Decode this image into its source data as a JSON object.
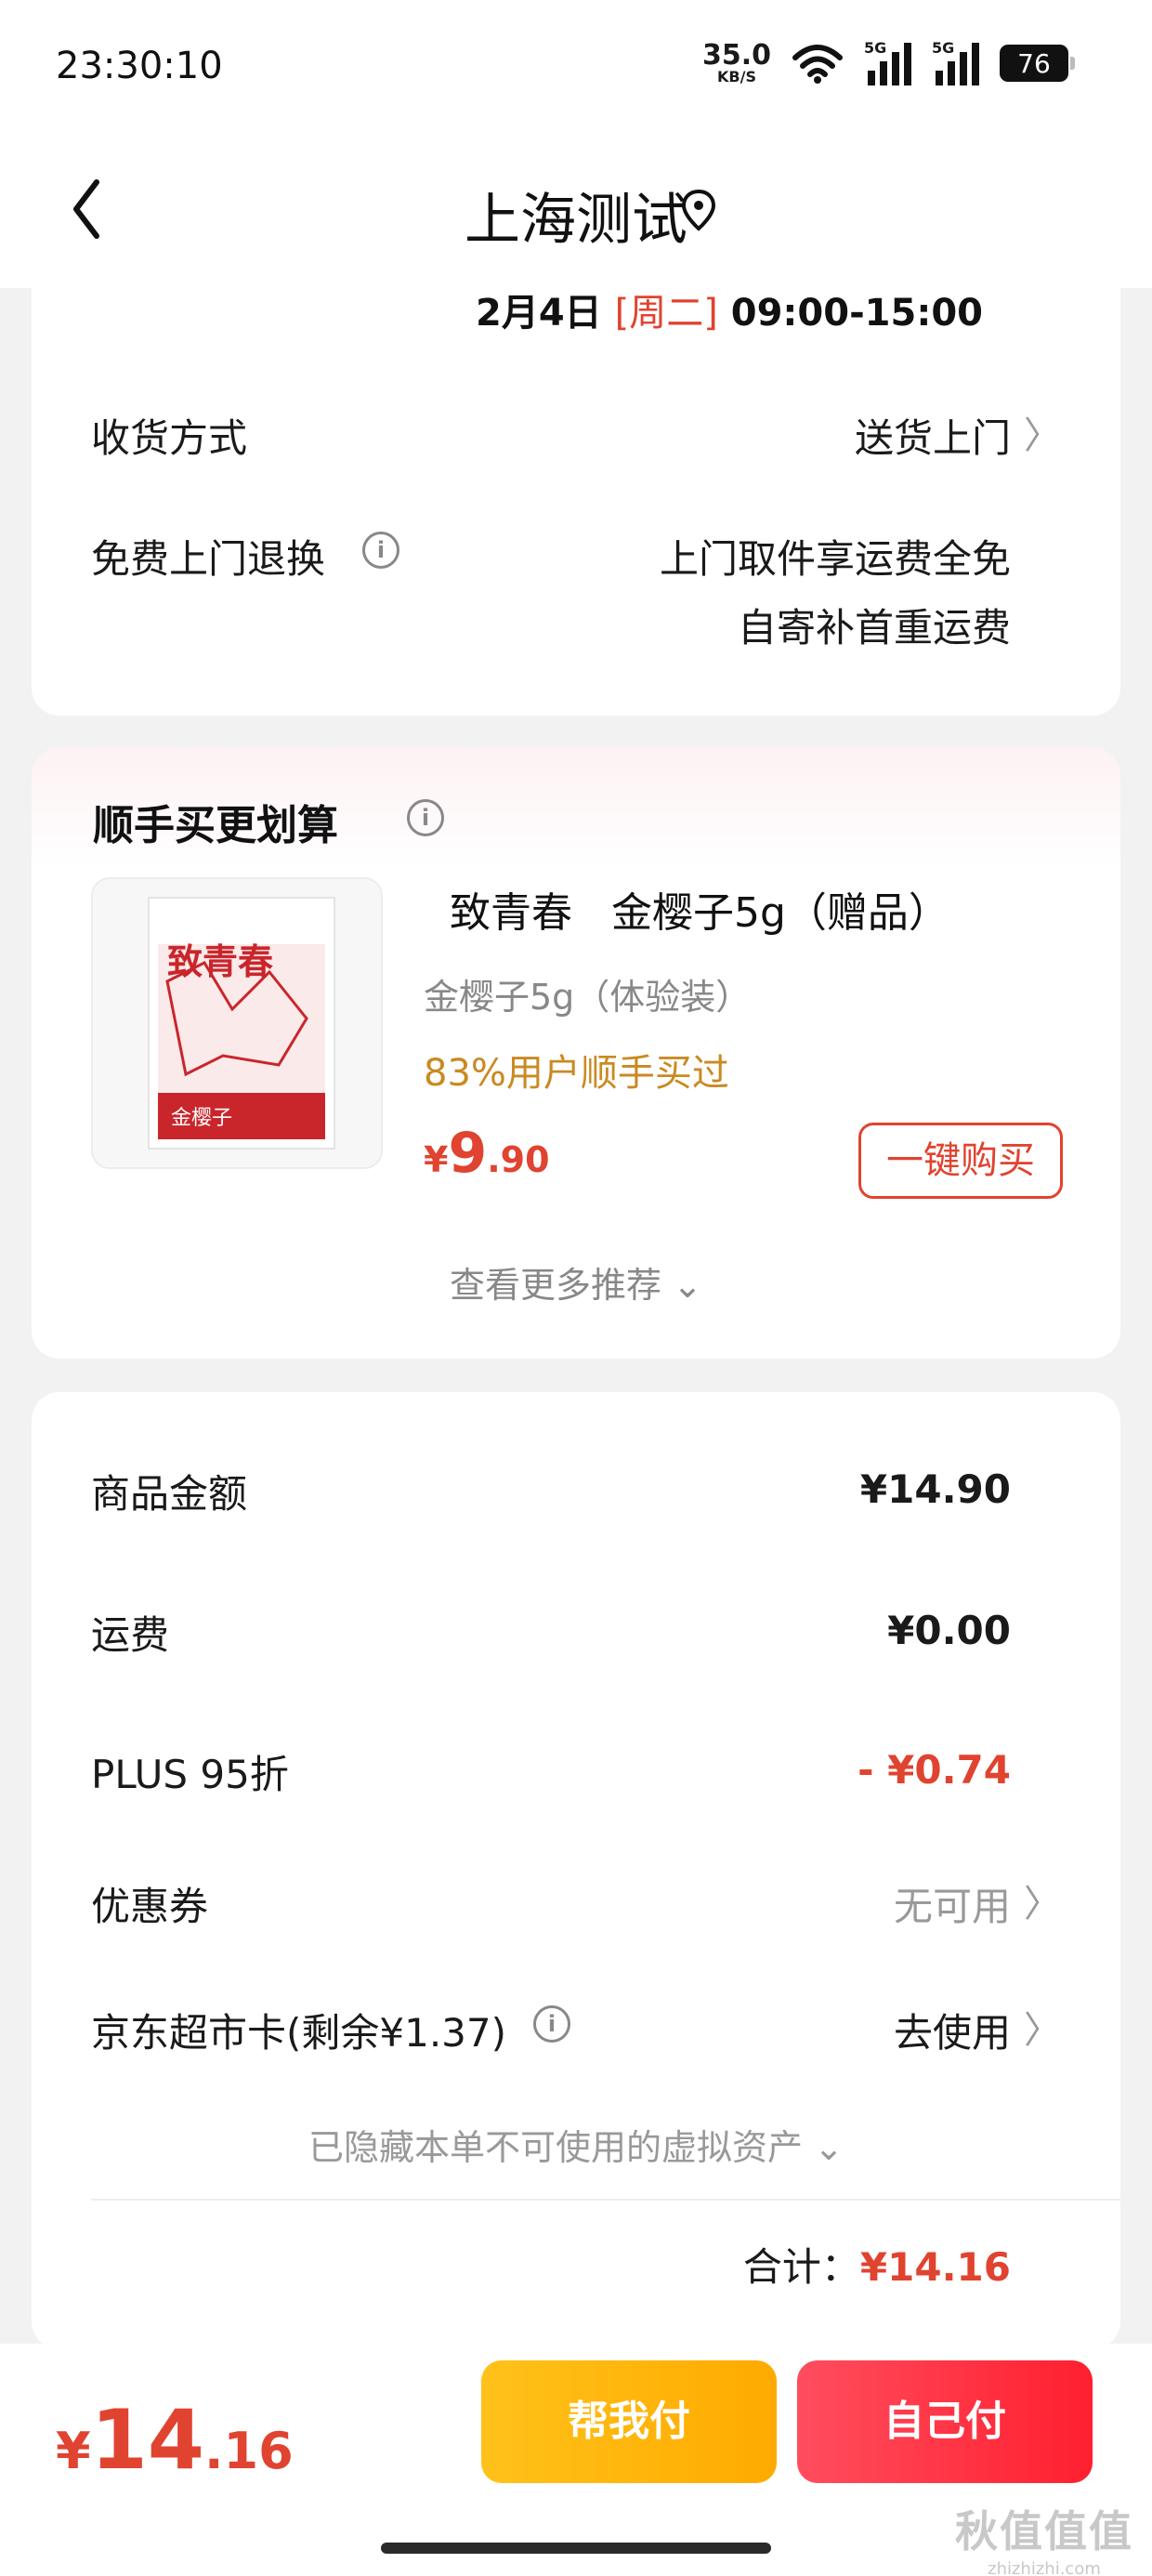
{
  "status_bar": {
    "time": "23:30:10",
    "net_speed_value": "35.0",
    "net_speed_unit": "KB/S",
    "signal1_tag": "5G",
    "signal2_tag": "5G",
    "battery": "76"
  },
  "nav": {
    "title": "上海测试",
    "back_icon": "chevron-left-icon",
    "location_icon": "location-pin-icon"
  },
  "delivery": {
    "date": "2月4日",
    "weekday": "[周二]",
    "time_range": "09:00-15:00",
    "method_label": "收货方式",
    "method_value": "送货上门",
    "return_label": "免费上门退换",
    "return_value_line1": "上门取件享运费全免",
    "return_value_line2": "自寄补首重运费"
  },
  "recommend": {
    "title": "顺手买更划算",
    "product": {
      "name": "致青春   金樱子5g（赠品）",
      "spec": "金樱子5g（体验装）",
      "buyers": "83%用户顺手买过",
      "price_symbol": "¥",
      "price_int": "9",
      "price_dec": ".90",
      "buy_button": "一键购买",
      "image_text": "致青春",
      "image_subtext": "金樱子"
    },
    "more": "查看更多推荐"
  },
  "summary": {
    "items": [
      {
        "label": "商品金额",
        "value": "¥14.90"
      },
      {
        "label": "运费",
        "value": "¥0.00"
      },
      {
        "label": "PLUS 95折",
        "value": "- ¥0.74"
      },
      {
        "label": "优惠券",
        "value": "无可用"
      },
      {
        "label": "京东超市卡(剩余¥1.37)",
        "value": "去使用"
      }
    ],
    "hidden_note": "已隐藏本单不可使用的虚拟资产",
    "total_label": "合计：",
    "total_value": "¥14.16"
  },
  "bottom": {
    "price_symbol": "¥",
    "price_int": "14",
    "price_dec": ".16",
    "help_pay": "帮我付",
    "self_pay": "自己付",
    "watermark_main": "秋值值值",
    "watermark_sub": "zhizhizhi.com"
  },
  "colors": {
    "accent_red": "#e0432f",
    "buyers_gold": "#c98a22",
    "help_btn": "#ffb60a",
    "self_btn": "#ff2f40"
  }
}
